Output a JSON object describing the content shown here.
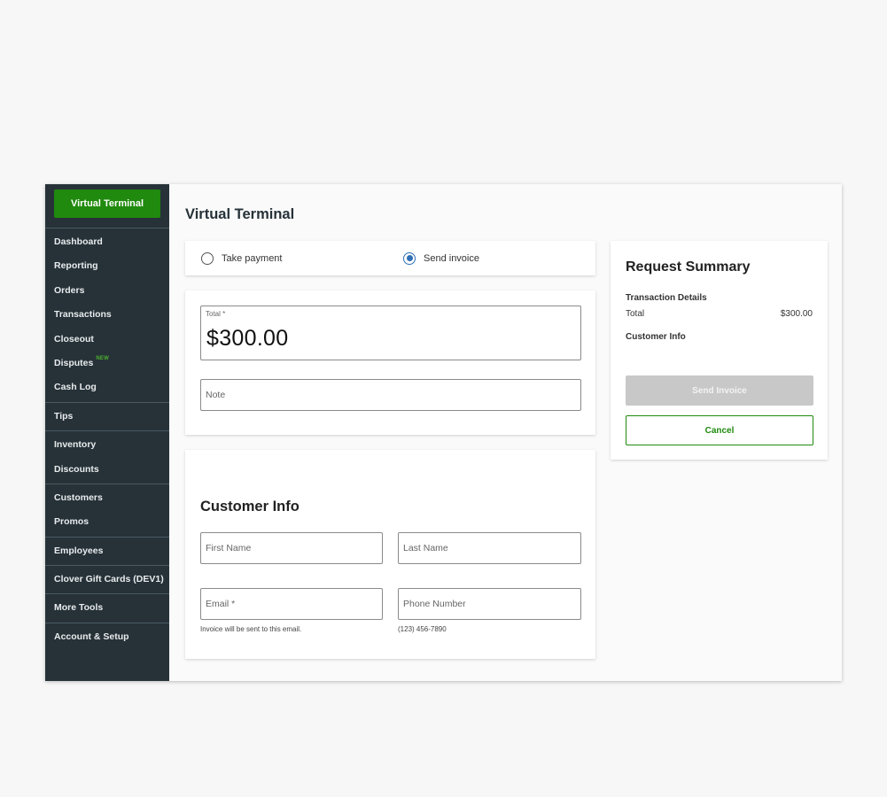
{
  "sidebar": {
    "primary_button": "Virtual Terminal",
    "groups": [
      [
        {
          "label": "Dashboard"
        },
        {
          "label": "Reporting"
        },
        {
          "label": "Orders"
        },
        {
          "label": "Transactions"
        },
        {
          "label": "Closeout"
        },
        {
          "label": "Disputes",
          "badge": "NEW"
        },
        {
          "label": "Cash Log"
        }
      ],
      [
        {
          "label": "Tips"
        }
      ],
      [
        {
          "label": "Inventory"
        },
        {
          "label": "Discounts"
        }
      ],
      [
        {
          "label": "Customers"
        },
        {
          "label": "Promos"
        }
      ],
      [
        {
          "label": "Employees"
        }
      ],
      [
        {
          "label": "Clover Gift Cards (DEV1)"
        }
      ],
      [
        {
          "label": "More Tools"
        }
      ],
      [
        {
          "label": "Account & Setup"
        }
      ]
    ]
  },
  "page": {
    "title": "Virtual Terminal"
  },
  "mode": {
    "option_take_payment": "Take payment",
    "option_send_invoice": "Send invoice",
    "selected": "send_invoice"
  },
  "amount": {
    "total_label": "Total *",
    "total_value": "$300.00",
    "note_placeholder": "Note"
  },
  "customer": {
    "title": "Customer Info",
    "first_name_placeholder": "First Name",
    "last_name_placeholder": "Last Name",
    "email_placeholder": "Email *",
    "phone_placeholder": "Phone Number",
    "email_hint": "Invoice will be sent to this email.",
    "phone_hint": "(123) 456-7890"
  },
  "summary": {
    "title": "Request Summary",
    "transaction_details_label": "Transaction Details",
    "total_label": "Total",
    "total_value": "$300.00",
    "customer_info_label": "Customer Info",
    "send_button": "Send Invoice",
    "cancel_button": "Cancel"
  },
  "colors": {
    "sidebar_bg": "#263238",
    "brand_green": "#208a0e",
    "radio_blue": "#2f6fb5",
    "badge_green": "#4caf2e",
    "disabled_button": "#c8c8c8"
  }
}
